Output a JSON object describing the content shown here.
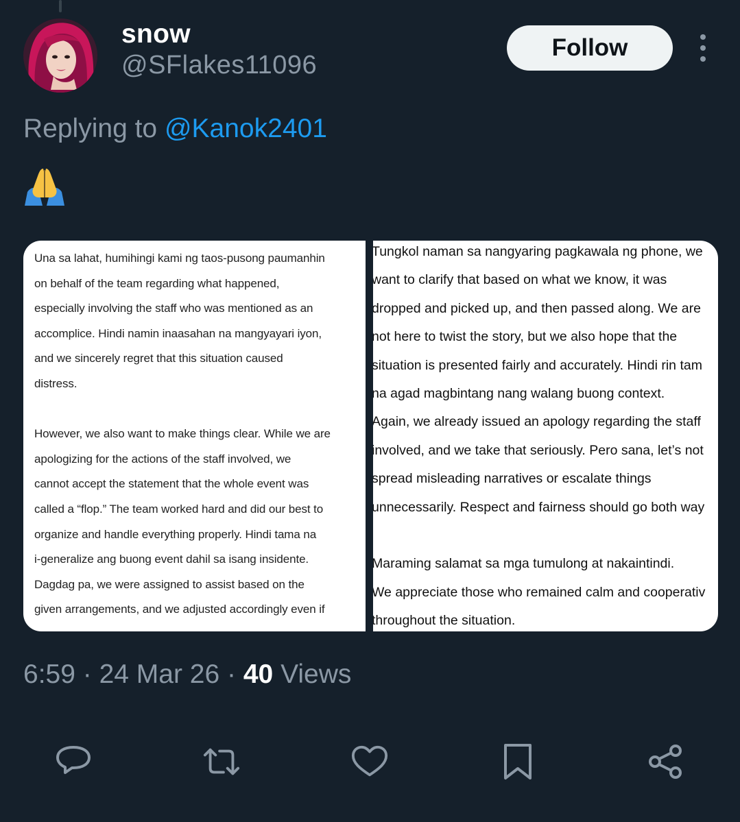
{
  "user": {
    "display_name": "snow",
    "handle": "@SFlakes11096",
    "avatar_icon": "profile-photo"
  },
  "follow_label": "Follow",
  "more_icon": "more-vertical-icon",
  "reply": {
    "prefix": "Replying to ",
    "mention": "@Kanok2401"
  },
  "tweet_emoji": "🙏",
  "media": {
    "left_lines": [
      "Una sa lahat, humihingi kami ng taos-pusong paumanhin",
      "on behalf of the team regarding what happened,",
      "especially involving the staff who was mentioned as an",
      "accomplice. Hindi namin inaasahan na mangyayari iyon,",
      "and we sincerely regret that this situation caused",
      "distress.",
      "",
      "However, we also want to make things clear. While we are",
      "apologizing for the actions of the staff involved, we",
      "cannot accept the statement that the whole event was",
      "called a “flop.” The team worked hard and did our best to",
      "organize and handle everything properly. Hindi tama na",
      "i-generalize ang buong event dahil sa isang insidente.",
      "Dagdag pa, we were assigned to assist based on the",
      "given arrangements, and we adjusted accordingly even if"
    ],
    "right_lines": [
      "Tungkol naman sa nangyaring pagkawala ng phone, we",
      "want to clarify that based on what we know, it was",
      "dropped and picked up, and then passed along. We are",
      "not here to twist the story, but we also hope that the",
      "situation is presented fairly and accurately. Hindi rin tam",
      "na agad magbintang nang walang buong context.",
      "Again, we already issued an apology regarding the staff",
      "involved, and we take that seriously. Pero sana, let’s not",
      "spread misleading narratives or escalate things",
      "unnecessarily. Respect and fairness should go both way",
      "",
      "Maraming salamat sa mga tumulong at nakaintindi.",
      "We appreciate those who remained calm and cooperativ",
      "throughout the situation."
    ]
  },
  "meta": {
    "time": "6:59",
    "separator": " · ",
    "date": "24 Mar 26",
    "views_count": "40",
    "views_label": " Views"
  },
  "actions": [
    {
      "name": "reply-icon"
    },
    {
      "name": "retweet-icon"
    },
    {
      "name": "like-icon"
    },
    {
      "name": "bookmark-icon"
    },
    {
      "name": "share-icon"
    }
  ],
  "colors": {
    "background": "#15202b",
    "secondary_text": "#8b98a5",
    "link": "#1d9bf0",
    "button_bg": "#eff3f4"
  }
}
